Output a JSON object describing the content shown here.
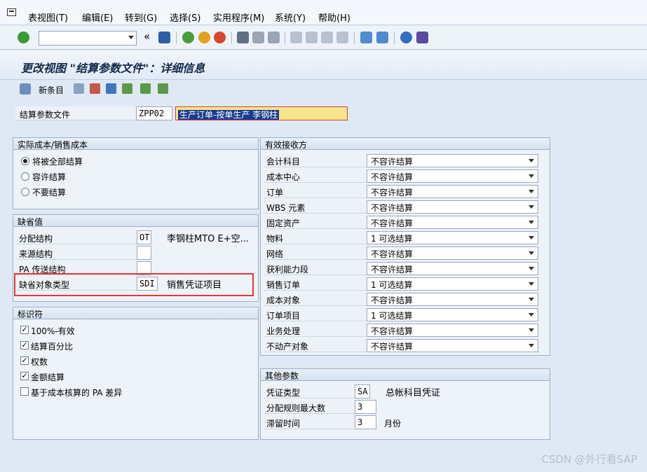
{
  "menu": [
    "表视图(T)",
    "编辑(E)",
    "转到(G)",
    "选择(S)",
    "实用程序(M)",
    "系统(Y)",
    "帮助(H)"
  ],
  "toolbar": {
    "back_glyph": "«"
  },
  "title": "更改视图 \"结算参数文件\"：详细信息",
  "app_toolbar": {
    "new_entries": "新条目"
  },
  "header": {
    "label": "结算参数文件",
    "code": "ZPP02",
    "description": "生产订单-按单生产 李钢柱"
  },
  "actual_cost": {
    "title": "实际成本/销售成本",
    "options": [
      {
        "label": "将被全部结算",
        "selected": true
      },
      {
        "label": "容许结算",
        "selected": false
      },
      {
        "label": "不要结算",
        "selected": false
      }
    ]
  },
  "defaults": {
    "title": "缺省值",
    "rows": [
      {
        "label": "分配结构",
        "value": "OT",
        "desc": "李钢柱MTO E+空..."
      },
      {
        "label": "来源结构",
        "value": "",
        "desc": ""
      },
      {
        "label": "PA 传送结构",
        "value": "",
        "desc": ""
      },
      {
        "label": "缺省对象类型",
        "value": "SDI",
        "desc": "销售凭证项目"
      }
    ]
  },
  "indicators": {
    "title": "标识符",
    "items": [
      {
        "label": "100%-有效",
        "checked": true
      },
      {
        "label": "结算百分比",
        "checked": true
      },
      {
        "label": "权数",
        "checked": true
      },
      {
        "label": "金额结算",
        "checked": true
      },
      {
        "label": "基于成本核算的 PA 差异",
        "checked": false
      }
    ]
  },
  "receivers": {
    "title": "有效接收方",
    "rows": [
      {
        "label": "会计科目",
        "value": "不容许结算"
      },
      {
        "label": "成本中心",
        "value": "不容许结算"
      },
      {
        "label": "订单",
        "value": "不容许结算"
      },
      {
        "label": "WBS 元素",
        "value": "不容许结算"
      },
      {
        "label": "固定资产",
        "value": "不容许结算"
      },
      {
        "label": "物料",
        "value": "1 可选结算"
      },
      {
        "label": "网络",
        "value": "不容许结算"
      },
      {
        "label": "获利能力段",
        "value": "不容许结算"
      },
      {
        "label": "销售订单",
        "value": "1 可选结算"
      },
      {
        "label": "成本对象",
        "value": "不容许结算"
      },
      {
        "label": "订单项目",
        "value": "1 可选结算"
      },
      {
        "label": "业务处理",
        "value": "不容许结算"
      },
      {
        "label": "不动产对象",
        "value": "不容许结算"
      }
    ]
  },
  "other": {
    "title": "其他参数",
    "rows": [
      {
        "label": "凭证类型",
        "value": "SA",
        "desc": "总帐科目凭证"
      },
      {
        "label": "分配规则最大数",
        "value": "3",
        "desc": ""
      },
      {
        "label": "滞留时间",
        "value": "3",
        "desc": "月份"
      }
    ]
  },
  "watermark": "CSDN @外行看SAP",
  "colors": {
    "highlight": "#e53935",
    "title": "#13294b"
  }
}
